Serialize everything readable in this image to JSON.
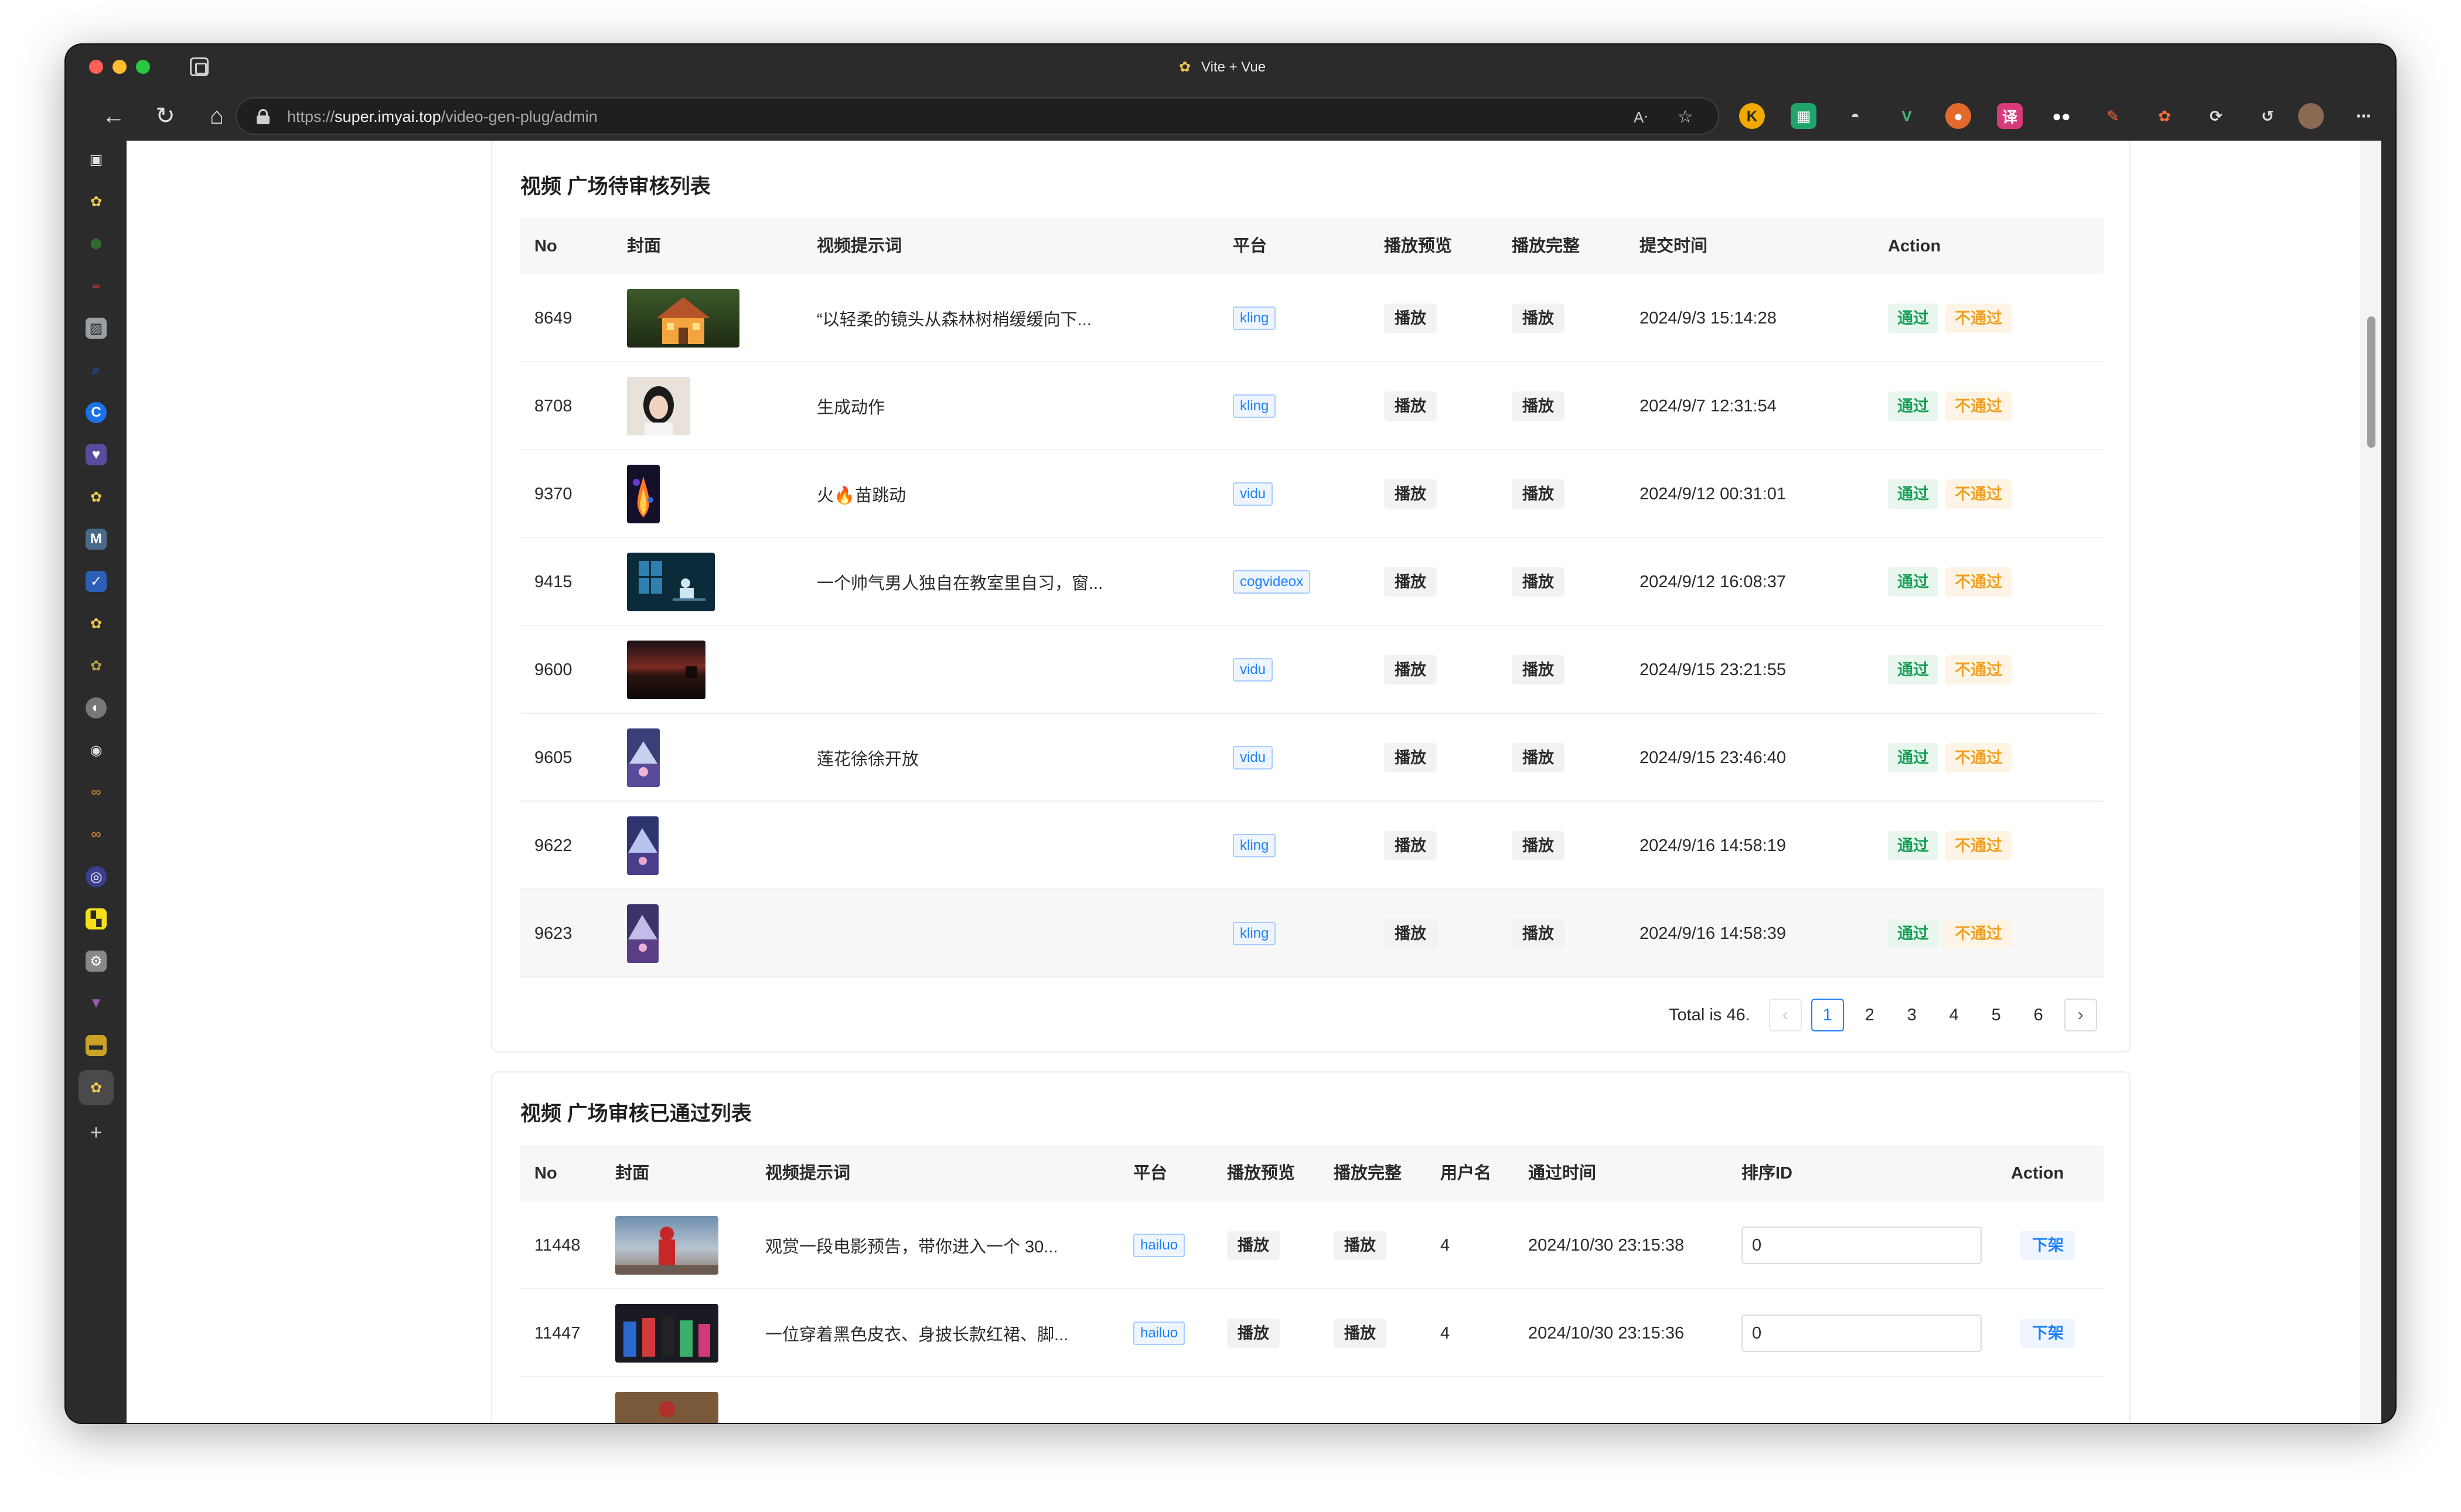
{
  "browser": {
    "window_title": "Vite + Vue",
    "url_scheme": "https://",
    "url_host": "super.imyai.top",
    "url_path": "/video-gen-plug/admin"
  },
  "colors": {
    "approve": "#18a058",
    "reject": "#f0a020",
    "link": "#1e80ff"
  },
  "pending": {
    "title": "视频 广场待审核列表",
    "headers": {
      "no": "No",
      "cover": "封面",
      "prompt": "视频提示词",
      "platform": "平台",
      "preview": "播放预览",
      "full": "播放完整",
      "submit_time": "提交时间",
      "action": "Action"
    },
    "rows": [
      {
        "no": "8649",
        "prompt": "“以轻柔的镜头从森林树梢缓缓向下...",
        "platform": "kling",
        "preview": "播放",
        "full": "播放",
        "time": "2024/9/3 15:14:28",
        "approve": "通过",
        "reject": "不通过"
      },
      {
        "no": "8708",
        "prompt": "生成动作",
        "platform": "kling",
        "preview": "播放",
        "full": "播放",
        "time": "2024/9/7 12:31:54",
        "approve": "通过",
        "reject": "不通过"
      },
      {
        "no": "9370",
        "prompt": "火🔥苗跳动",
        "platform": "vidu",
        "preview": "播放",
        "full": "播放",
        "time": "2024/9/12 00:31:01",
        "approve": "通过",
        "reject": "不通过"
      },
      {
        "no": "9415",
        "prompt": "一个帅气男人独自在教室里自习，窗...",
        "platform": "cogvideox",
        "preview": "播放",
        "full": "播放",
        "time": "2024/9/12 16:08:37",
        "approve": "通过",
        "reject": "不通过"
      },
      {
        "no": "9600",
        "prompt": "",
        "platform": "vidu",
        "preview": "播放",
        "full": "播放",
        "time": "2024/9/15 23:21:55",
        "approve": "通过",
        "reject": "不通过"
      },
      {
        "no": "9605",
        "prompt": "莲花徐徐开放",
        "platform": "vidu",
        "preview": "播放",
        "full": "播放",
        "time": "2024/9/15 23:46:40",
        "approve": "通过",
        "reject": "不通过"
      },
      {
        "no": "9622",
        "prompt": "",
        "platform": "kling",
        "preview": "播放",
        "full": "播放",
        "time": "2024/9/16 14:58:19",
        "approve": "通过",
        "reject": "不通过"
      },
      {
        "no": "9623",
        "prompt": "",
        "platform": "kling",
        "preview": "播放",
        "full": "播放",
        "time": "2024/9/16 14:58:39",
        "approve": "通过",
        "reject": "不通过"
      }
    ],
    "pagination": {
      "total_text": "Total is 46.",
      "pages": [
        "1",
        "2",
        "3",
        "4",
        "5",
        "6"
      ],
      "current": "1"
    }
  },
  "approved": {
    "title": "视频 广场审核已通过列表",
    "headers": {
      "no": "No",
      "cover": "封面",
      "prompt": "视频提示词",
      "platform": "平台",
      "preview": "播放预览",
      "full": "播放完整",
      "username": "用户名",
      "pass_time": "通过时间",
      "sort_id": "排序ID",
      "action": "Action"
    },
    "rows": [
      {
        "no": "11448",
        "prompt": "观赏一段电影预告，带你进入一个 30...",
        "platform": "hailuo",
        "preview": "播放",
        "full": "播放",
        "username": "4",
        "time": "2024/10/30 23:15:38",
        "sort_id": "0",
        "takedown": "下架"
      },
      {
        "no": "11447",
        "prompt": "一位穿着黑色皮衣、身披长款红裙、脚...",
        "platform": "hailuo",
        "preview": "播放",
        "full": "播放",
        "username": "4",
        "time": "2024/10/30 23:15:36",
        "sort_id": "0",
        "takedown": "下架"
      }
    ]
  }
}
